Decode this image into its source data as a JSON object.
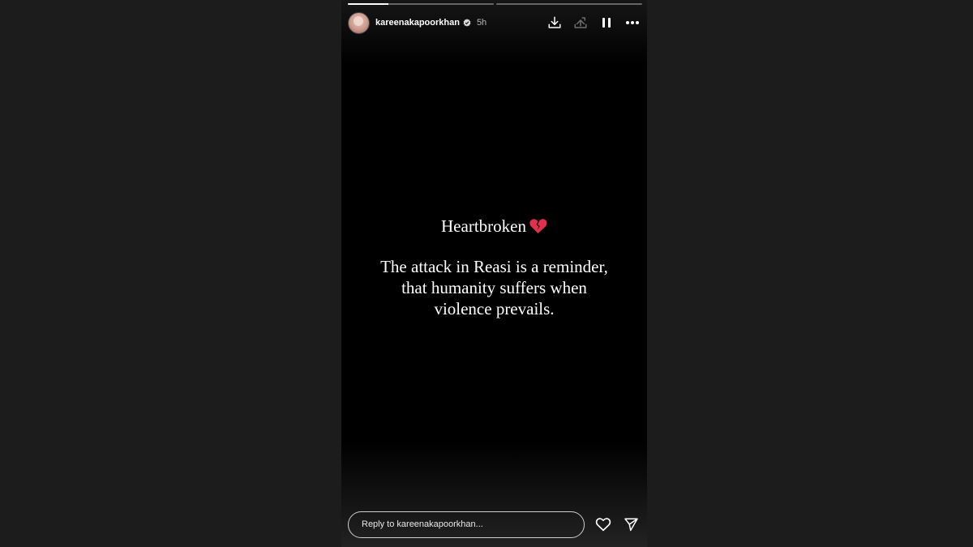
{
  "story": {
    "progress": [
      {
        "fraction": 0.28
      },
      {
        "fraction": 0.0
      }
    ],
    "header": {
      "username": "kareenakapoorkhan",
      "time": "5h",
      "verified": true
    },
    "icons": {
      "download": "download-icon",
      "share": "share-icon",
      "pause": "pause-icon",
      "more": "more-icon",
      "heart": "heart-icon",
      "send": "send-icon",
      "broken_heart": "broken-heart-emoji"
    },
    "text": {
      "title": "Heartbroken",
      "line1": "The attack in Reasi is a reminder,",
      "line2": "that humanity suffers when",
      "line3": "violence prevails."
    },
    "reply": {
      "placeholder": "Reply to kareenakapoorkhan..."
    },
    "colors": {
      "page_bg": "#1c1c1c",
      "story_bg": "#000000",
      "broken_heart": "#e0314b"
    }
  }
}
